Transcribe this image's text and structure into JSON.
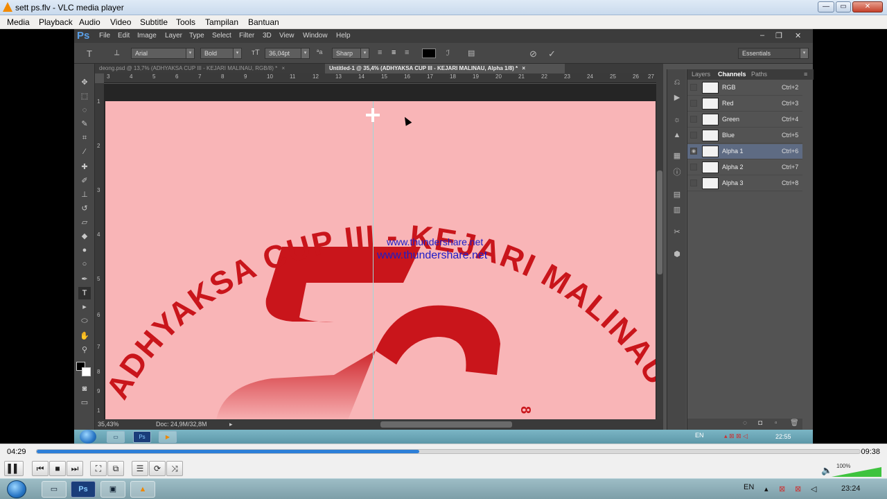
{
  "vlc": {
    "title": "sett ps.flv - VLC media player",
    "menu": [
      "Media",
      "Playback",
      "Audio",
      "Video",
      "Subtitle",
      "Tools",
      "Tampilan",
      "Bantuan"
    ],
    "window_buttons": {
      "minimize": "—",
      "maximize": "▭",
      "close": "✕"
    },
    "time_current": "04:29",
    "time_total": "09:38",
    "progress": 0.465,
    "volume_label": "100%",
    "volume": 1.0
  },
  "photoshop": {
    "logo": "Ps",
    "menu": [
      "File",
      "Edit",
      "Image",
      "Layer",
      "Type",
      "Select",
      "Filter",
      "3D",
      "View",
      "Window",
      "Help"
    ],
    "options": {
      "font_family": "Arial",
      "font_style": "Bold",
      "font_size": "36,04pt",
      "antialias": "Sharp",
      "workspace": "Essentials"
    },
    "tabs": [
      {
        "label": "deong.psd @ 13,7% (ADHYAKSA CUP III - KEJARI MALINAU, RGB/8) *",
        "active": false
      },
      {
        "label": "Untitled-1 @ 35,4% (ADHYAKSA CUP III - KEJARI MALINAU, Alpha 1/8) *",
        "active": true
      }
    ],
    "ruler_h": [
      "3",
      "4",
      "5",
      "6",
      "7",
      "8",
      "9",
      "10",
      "11",
      "12",
      "13",
      "14",
      "15",
      "16",
      "17",
      "18",
      "19",
      "20",
      "21",
      "22",
      "23",
      "24",
      "25",
      "26",
      "27"
    ],
    "ruler_v": [
      "1",
      "2",
      "3",
      "4",
      "5",
      "6",
      "7",
      "8",
      "9",
      "1"
    ],
    "canvas": {
      "arc_text": "ADHYAKSA CUP III - KEJARI MALINAU",
      "url_1": "www.thundershare.net",
      "url_2": "www.thundershare.net",
      "numeral_fragment": "8"
    },
    "status": {
      "zoom": "35,43%",
      "doc": "Doc: 24,9M/32,8M"
    },
    "panel_tabs": [
      "Layers",
      "Channels",
      "Paths"
    ],
    "channels": [
      {
        "name": "RGB",
        "shortcut": "Ctrl+2"
      },
      {
        "name": "Red",
        "shortcut": "Ctrl+3"
      },
      {
        "name": "Green",
        "shortcut": "Ctrl+4"
      },
      {
        "name": "Blue",
        "shortcut": "Ctrl+5"
      },
      {
        "name": "Alpha 1",
        "shortcut": "Ctrl+6"
      },
      {
        "name": "Alpha 2",
        "shortcut": "Ctrl+7"
      },
      {
        "name": "Alpha 3",
        "shortcut": "Ctrl+8"
      }
    ],
    "active_channel": "Alpha 1"
  },
  "inner_taskbar": {
    "lang": "EN",
    "clock": "22:55"
  },
  "outer_taskbar": {
    "lang": "EN",
    "clock": "23:24"
  },
  "colors": {
    "canvas": "#f9b5b7",
    "text_red": "#c9151b",
    "url_blue": "#1c1cc8",
    "seek_blue": "#2d7fd8"
  }
}
